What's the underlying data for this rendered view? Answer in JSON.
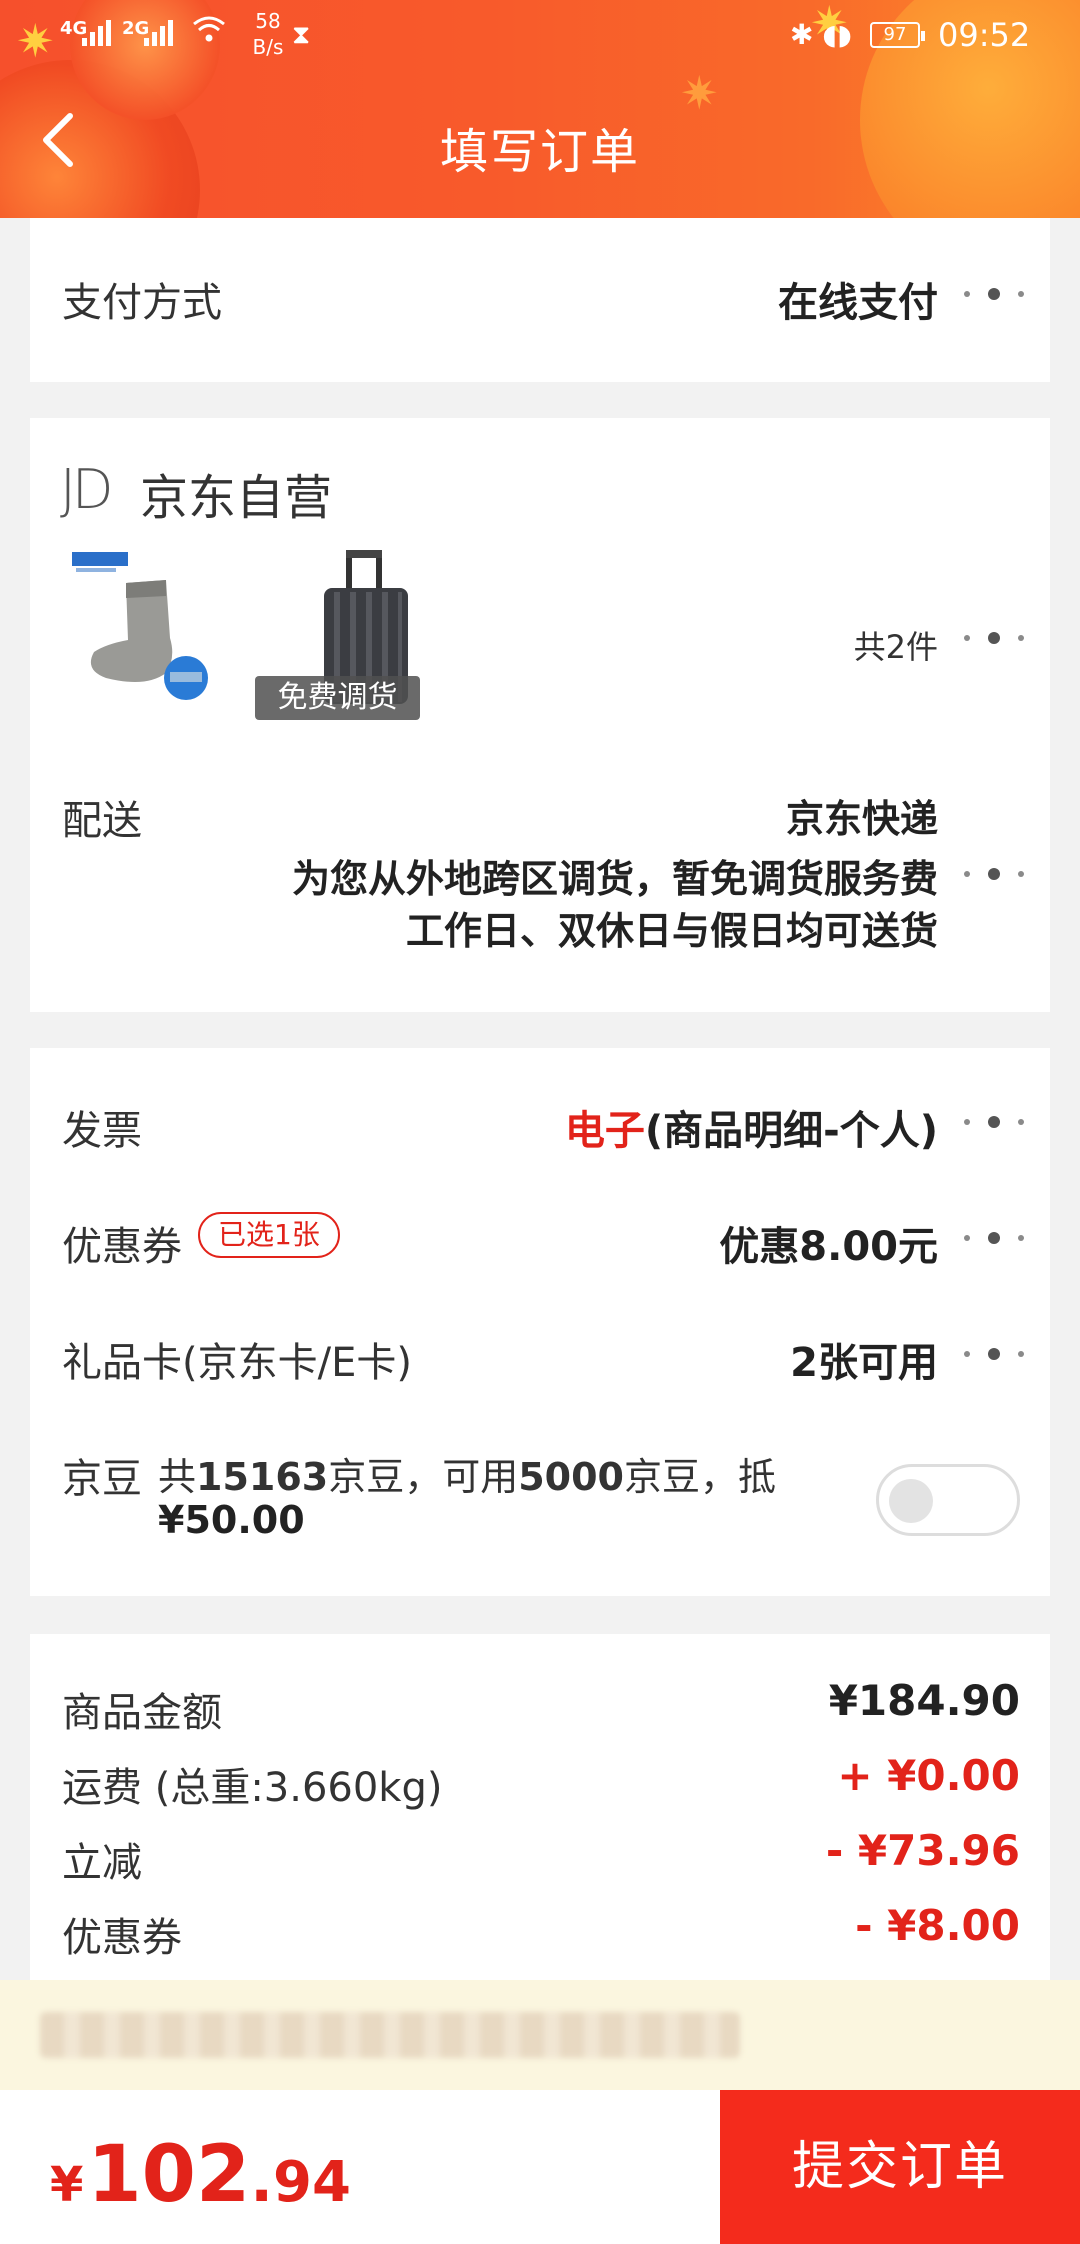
{
  "status_bar": {
    "net1": "4G",
    "net2": "2G",
    "speed_value": "58",
    "speed_unit": "B/s",
    "battery": "97",
    "time": "09:52"
  },
  "header": {
    "title": "填写订单"
  },
  "payment": {
    "label": "支付方式",
    "value": "在线支付"
  },
  "shop": {
    "name": "京东自营",
    "count_text": "共2件",
    "free_transfer_badge": "免费调货",
    "delivery_label": "配送",
    "delivery_method": "京东快递",
    "delivery_note1": "为您从外地跨区调货，暂免调货服务费",
    "delivery_note2": "工作日、双休日与假日均可送货"
  },
  "invoice": {
    "label": "发票",
    "value_red": "电子",
    "value_rest": "(商品明细-个人)"
  },
  "coupon": {
    "label": "优惠券",
    "tag": "已选1张",
    "value": "优惠8.00元"
  },
  "gift_card": {
    "label": "礼品卡(京东卡/E卡)",
    "value": "2张可用"
  },
  "jingdou": {
    "label": "京豆",
    "text_part1_a": "共",
    "text_part1_b": "15163",
    "text_part1_c": "京豆，可用",
    "text_part1_d": "5000",
    "text_part1_e": "京豆，抵",
    "text_part2": "¥50.00",
    "toggle_on": false
  },
  "summary": [
    {
      "label": "商品金额",
      "value": "¥184.90",
      "color": "#222222"
    },
    {
      "label": "运费 (总重:3.660kg)",
      "value": "+ ¥0.00",
      "color": "#e2231a"
    },
    {
      "label": "立减",
      "value": "- ¥73.96",
      "color": "#e2231a"
    },
    {
      "label": "优惠券",
      "value": "- ¥8.00",
      "color": "#e2231a"
    }
  ],
  "bottom": {
    "currency": "¥",
    "total_int": "102",
    "total_dot": ".",
    "total_dec": "94",
    "submit_label": "提交订单"
  },
  "colors": {
    "accent": "#e2231a",
    "header": "#f6502c"
  }
}
